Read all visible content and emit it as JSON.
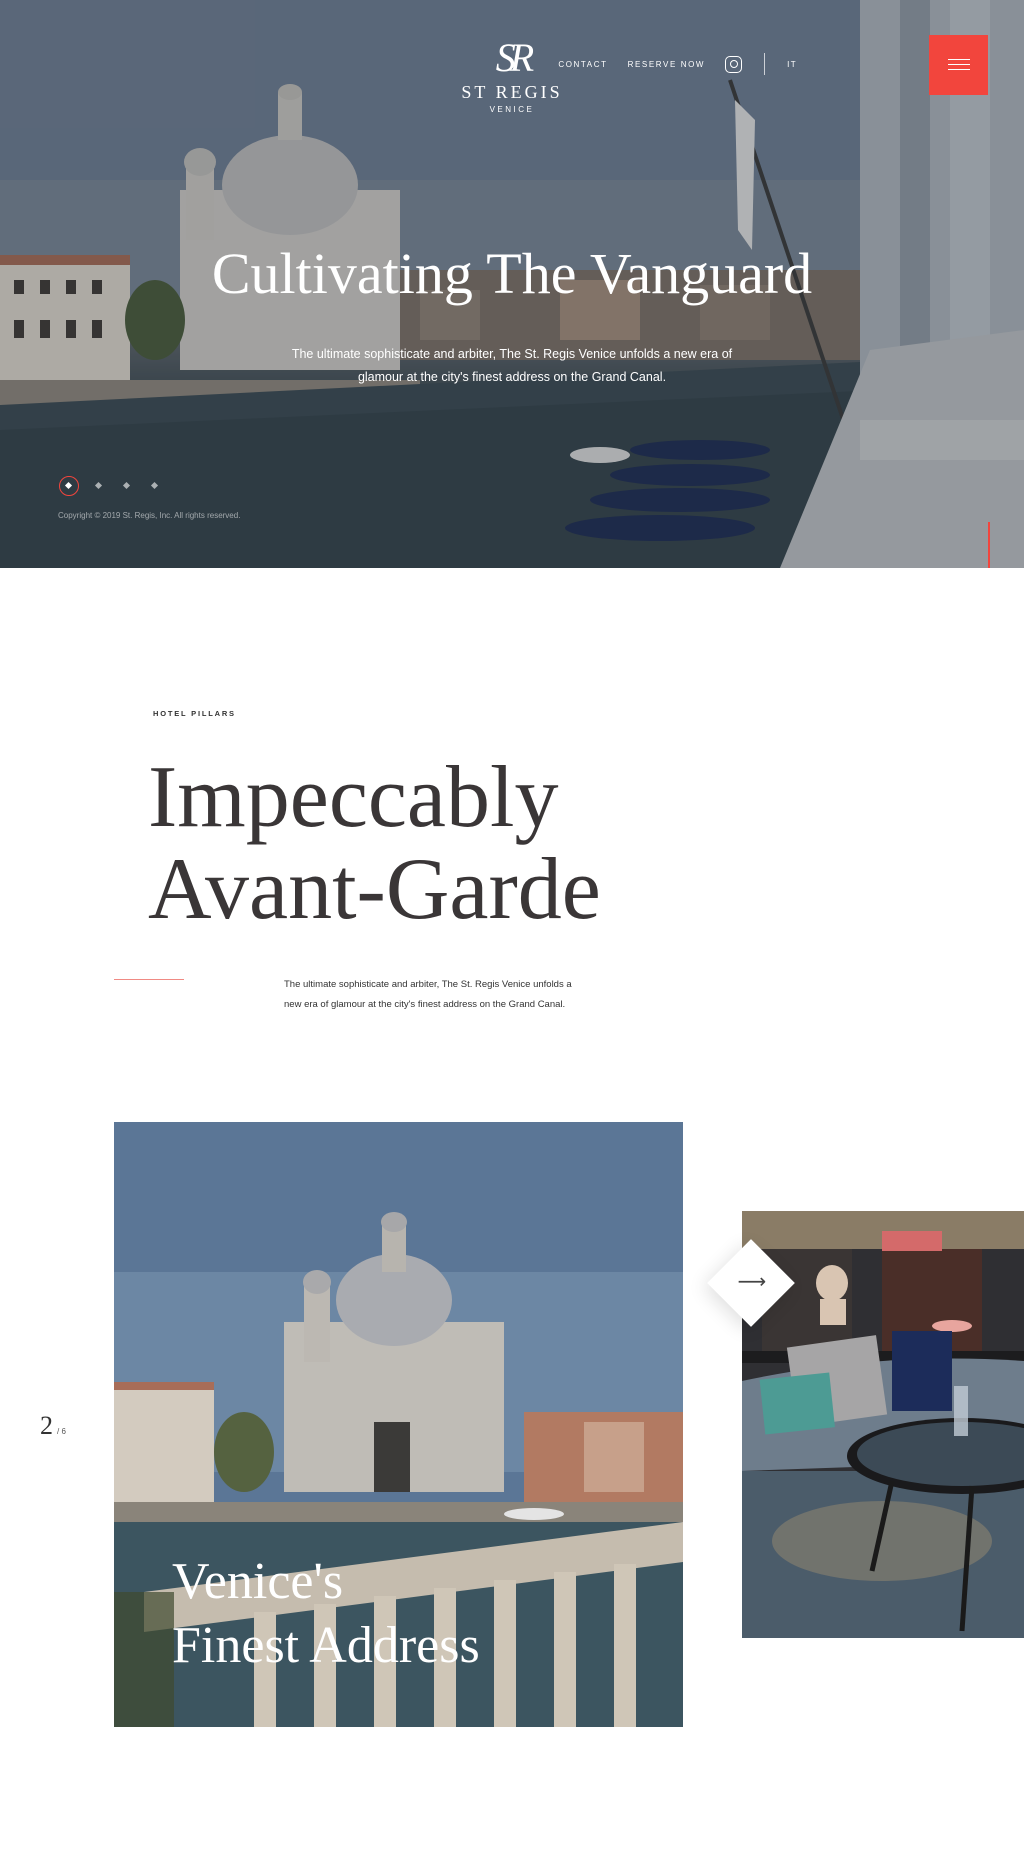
{
  "brand": {
    "mark": "SR",
    "name": "ST REGIS",
    "location": "VENICE"
  },
  "nav": {
    "contact": "CONTACT",
    "reserve": "RESERVE NOW",
    "lang": "IT",
    "instagram_icon": "instagram-icon",
    "menu_icon": "hamburger-icon"
  },
  "hero": {
    "title": "Cultivating The Vanguard",
    "subtitle": "The ultimate sophisticate and arbiter, The St. Regis Venice unfolds a new era of glamour at the city's finest address on the Grand Canal.",
    "slides_total": 4,
    "slide_active": 1,
    "copyright": "Copyright © 2019 St. Regis, Inc. All rights reserved."
  },
  "pillars": {
    "eyebrow": "HOTEL PILLARS",
    "title_line1": "Impeccably",
    "title_line2": "Avant-Garde",
    "body": "The ultimate sophisticate and arbiter, The St. Regis Venice unfolds a new era of glamour at the city's finest address on the Grand Canal."
  },
  "carousel": {
    "current": "2",
    "total": "/ 6",
    "card_title_line1": "Venice's",
    "card_title_line2": "Finest Address",
    "next_icon": "arrow-right-icon"
  },
  "colors": {
    "accent": "#f2453d",
    "text_dark": "#3a3637"
  }
}
